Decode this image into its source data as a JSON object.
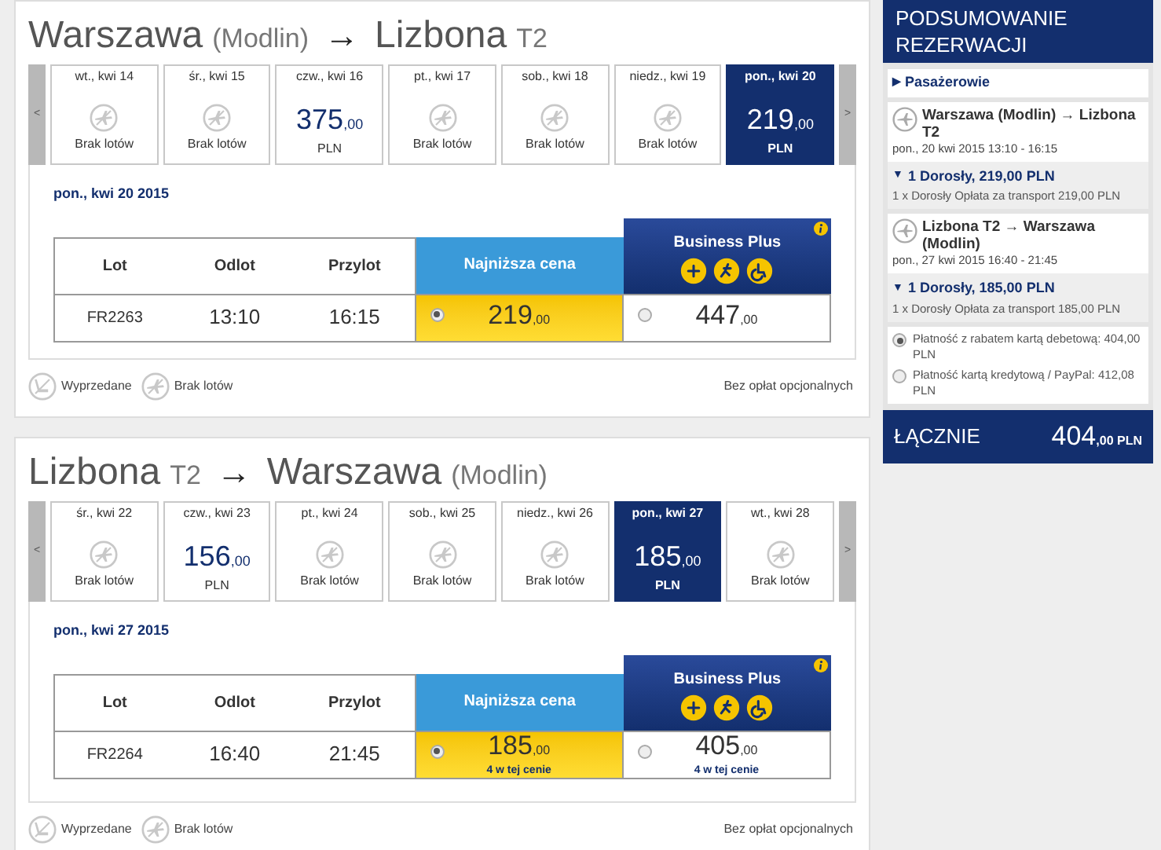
{
  "journeys": [
    {
      "title": {
        "origin": "Warszawa",
        "origin_detail": "(Modlin)",
        "arrow": "→",
        "destination": "Lizbona",
        "destination_detail": "T2"
      },
      "prev": "<",
      "next": ">",
      "days": [
        {
          "label": "wt., kwi 14",
          "kind": "none",
          "status": "Brak lotów",
          "selected": false
        },
        {
          "label": "śr., kwi 15",
          "kind": "none",
          "status": "Brak lotów",
          "selected": false
        },
        {
          "label": "czw., kwi 16",
          "kind": "price",
          "price": "375",
          "decimals": ",00",
          "currency": "PLN",
          "selected": false
        },
        {
          "label": "pt., kwi 17",
          "kind": "none",
          "status": "Brak lotów",
          "selected": false
        },
        {
          "label": "sob., kwi 18",
          "kind": "none",
          "status": "Brak lotów",
          "selected": false
        },
        {
          "label": "niedz., kwi 19",
          "kind": "none",
          "status": "Brak lotów",
          "selected": false
        },
        {
          "label": "pon., kwi 20",
          "kind": "price",
          "price": "219",
          "decimals": ",00",
          "currency": "PLN",
          "selected": true
        }
      ],
      "date": "pon., kwi 20 2015",
      "columns": [
        "Lot",
        "Odlot",
        "Przylot"
      ],
      "fare_columns": [
        {
          "title": "Najniższa cena",
          "kind": "standard"
        },
        {
          "title": "Business Plus",
          "kind": "business"
        }
      ],
      "row": {
        "flight": "FR2263",
        "departure": "13:10",
        "arrival": "16:15",
        "fares": [
          {
            "price": "219",
            "decimals": ",00",
            "selected": true
          },
          {
            "price": "447",
            "decimals": ",00",
            "selected": false
          }
        ]
      },
      "legend": [
        {
          "kind": "sold_out",
          "label": "Wyprzedane"
        },
        {
          "kind": "no_flights",
          "label": "Brak lotów"
        }
      ],
      "note": "Bez opłat opcjonalnych"
    },
    {
      "title": {
        "origin": "Lizbona",
        "origin_detail": "T2",
        "arrow": "→",
        "destination": "Warszawa",
        "destination_detail": "(Modlin)"
      },
      "prev": "<",
      "next": ">",
      "days": [
        {
          "label": "śr., kwi 22",
          "kind": "none",
          "status": "Brak lotów",
          "selected": false
        },
        {
          "label": "czw., kwi 23",
          "kind": "price",
          "price": "156",
          "decimals": ",00",
          "currency": "PLN",
          "selected": false
        },
        {
          "label": "pt., kwi 24",
          "kind": "none",
          "status": "Brak lotów",
          "selected": false
        },
        {
          "label": "sob., kwi 25",
          "kind": "none",
          "status": "Brak lotów",
          "selected": false
        },
        {
          "label": "niedz., kwi 26",
          "kind": "none",
          "status": "Brak lotów",
          "selected": false
        },
        {
          "label": "pon., kwi 27",
          "kind": "price",
          "price": "185",
          "decimals": ",00",
          "currency": "PLN",
          "selected": true
        },
        {
          "label": "wt., kwi 28",
          "kind": "none",
          "status": "Brak lotów",
          "selected": false
        }
      ],
      "date": "pon., kwi 27 2015",
      "columns": [
        "Lot",
        "Odlot",
        "Przylot"
      ],
      "fare_columns": [
        {
          "title": "Najniższa cena",
          "kind": "standard"
        },
        {
          "title": "Business Plus",
          "kind": "business"
        }
      ],
      "row": {
        "flight": "FR2264",
        "departure": "16:40",
        "arrival": "21:45",
        "fares": [
          {
            "price": "185",
            "decimals": ",00",
            "selected": true,
            "note": "4 w tej cenie"
          },
          {
            "price": "405",
            "decimals": ",00",
            "selected": false,
            "note": "4 w tej cenie"
          }
        ]
      },
      "legend": [
        {
          "kind": "sold_out",
          "label": "Wyprzedane"
        },
        {
          "kind": "no_flights",
          "label": "Brak lotów"
        }
      ],
      "note": "Bez opłat opcjonalnych"
    }
  ],
  "summary": {
    "title": "PODSUMOWANIE REZERWACJI",
    "passengers": {
      "marker": "▶",
      "label": "Pasażerowie"
    },
    "segments": [
      {
        "route": "Warszawa (Modlin) → Lizbona T2",
        "when": "pon., 20 kwi 2015 13:10 - 16:15",
        "marker": "▼",
        "summary": "1 Dorosły, 219,00 PLN",
        "detail": "1 x Dorosły Opłata za transport 219,00 PLN"
      },
      {
        "route": "Lizbona T2 → Warszawa (Modlin)",
        "when": "pon., 27 kwi 2015 16:40 - 21:45",
        "marker": "▼",
        "summary": "1 Dorosły, 185,00 PLN",
        "detail": "1 x Dorosły Opłata za transport 185,00 PLN"
      }
    ],
    "payments": [
      {
        "label": "Płatność z rabatem kartą debetową: 404,00 PLN",
        "selected": true
      },
      {
        "label": "Płatność kartą kredytową / PayPal: 412,08 PLN",
        "selected": false
      }
    ],
    "total": {
      "label": "ŁĄCZNIE",
      "amount": "404",
      "decimals": ",00",
      "currency": "PLN"
    }
  }
}
